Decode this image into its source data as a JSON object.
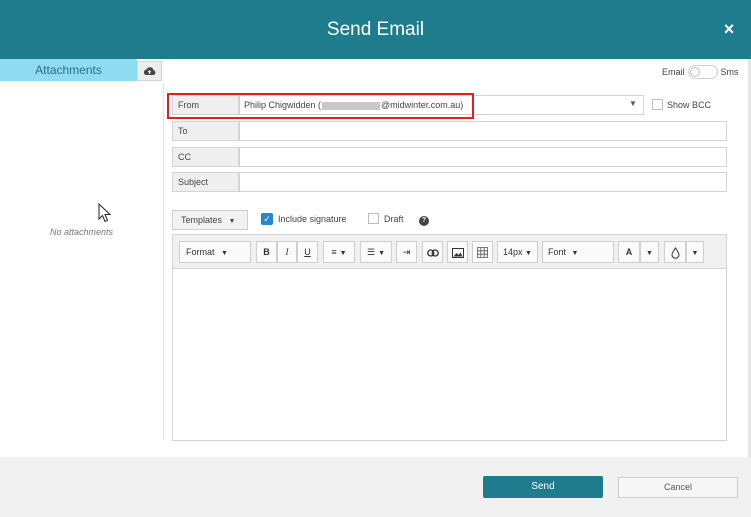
{
  "dialog": {
    "title": "Send Email",
    "close": "×"
  },
  "sidebar": {
    "tab_label": "Attachments",
    "empty_text": "No attachments"
  },
  "toggle": {
    "left_label": "Email",
    "right_label": "Sms"
  },
  "fields": {
    "from_label": "From",
    "from_name": "Philip Chigwidden (",
    "from_domain": "@midwinter.com.au)",
    "to_label": "To",
    "cc_label": "CC",
    "subject_label": "Subject",
    "show_bcc": "Show BCC"
  },
  "options": {
    "templates": "Templates",
    "include_signature": "Include signature",
    "draft": "Draft",
    "help": "?"
  },
  "toolbar": {
    "format": "Format",
    "bold": "B",
    "italic": "I",
    "underline": "U",
    "font_size": "14px",
    "font": "Font",
    "text_color": "A"
  },
  "footer": {
    "send": "Send",
    "cancel": "Cancel"
  }
}
